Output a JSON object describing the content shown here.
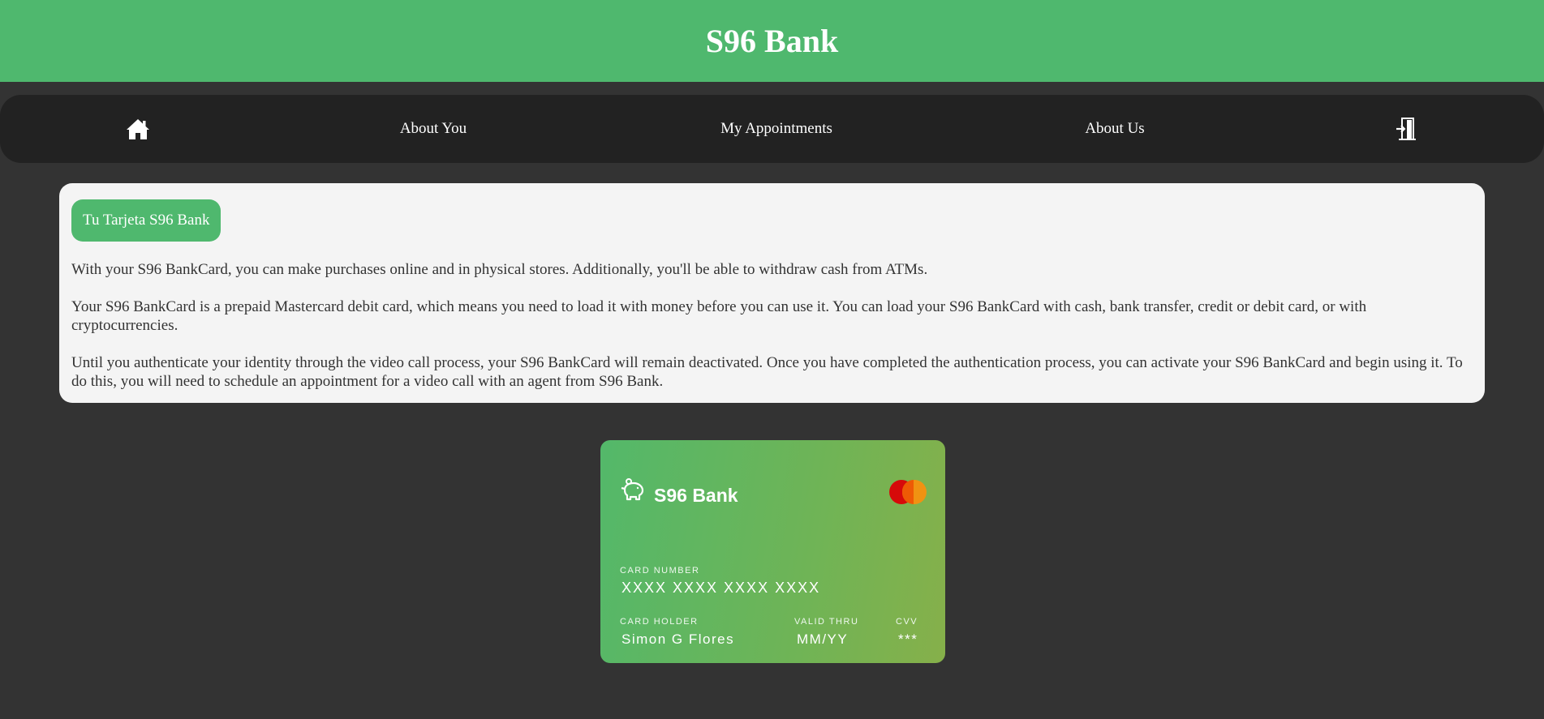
{
  "header": {
    "title": "S96 Bank"
  },
  "nav": {
    "home_icon": "home-icon",
    "about_you": "About You",
    "my_appointments": "My Appointments",
    "about_us": "About Us",
    "logout_icon": "door-exit-icon"
  },
  "info": {
    "badge": "Tu Tarjeta S96 Bank",
    "paragraph1": "With your S96 BankCard, you can make purchases online and in physical stores. Additionally, you'll be able to withdraw cash from ATMs.",
    "paragraph2": "Your S96 BankCard is a prepaid Mastercard debit card, which means you need to load it with money before you can use it. You can load your S96 BankCard with cash, bank transfer, credit or debit card, or with cryptocurrencies.",
    "paragraph3": "Until you authenticate your identity through the video call process, your S96 BankCard will remain deactivated. Once you have completed the authentication process, you can activate your S96 BankCard and begin using it. To do this, you will need to schedule an appointment for a video call with an agent from S96 Bank."
  },
  "card": {
    "bank_name": "S96 Bank",
    "logo_icon": "piggy-bank-icon",
    "network_icon": "mastercard-logo",
    "number_label": "CARD NUMBER",
    "number": "XXXX XXXX XXXX XXXX",
    "holder_label": "CARD HOLDER",
    "holder": "Simon G Flores",
    "valid_label": "VALID THRU",
    "valid": "MM/YY",
    "cvv_label": "CVV",
    "cvv": "***"
  },
  "colors": {
    "brand_green": "#4fb86e",
    "page_background": "#333333",
    "nav_background": "#222222",
    "panel_background": "#f4f4f4"
  }
}
